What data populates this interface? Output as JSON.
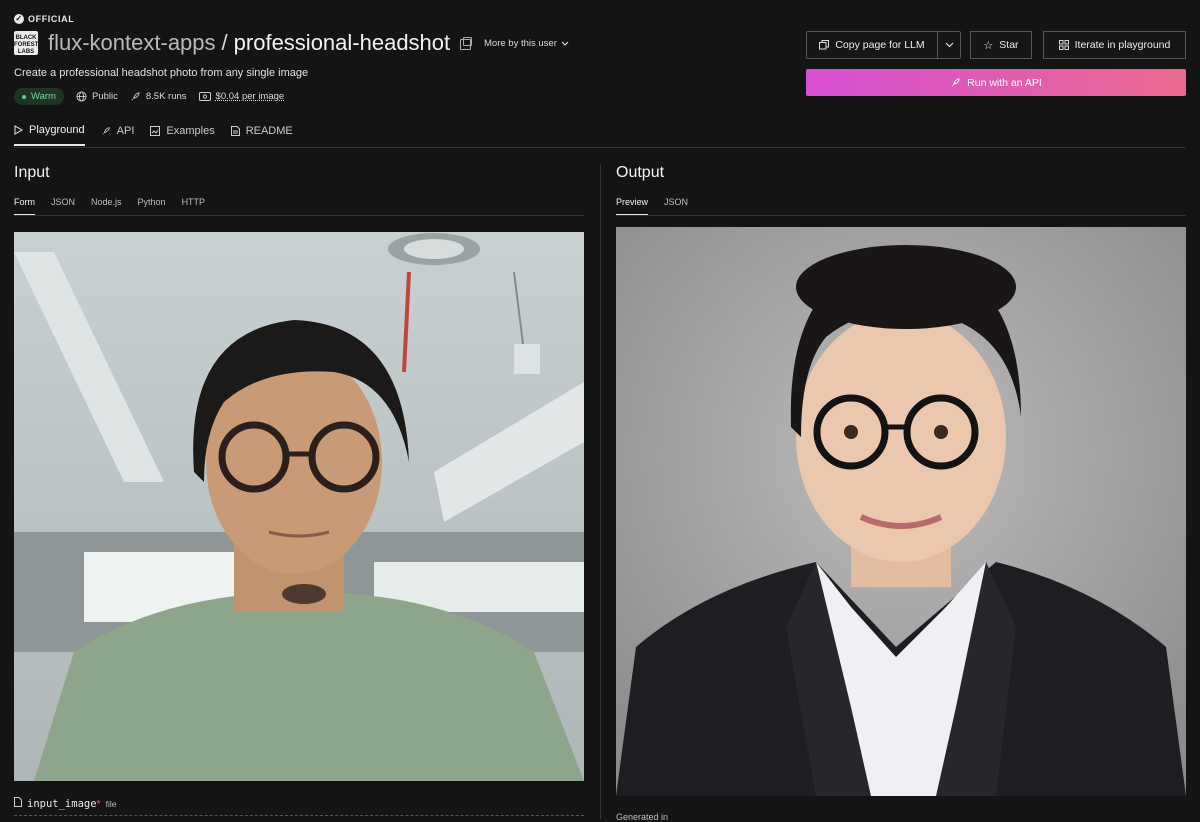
{
  "header": {
    "official": "OFFICIAL",
    "logo_text": "BLACK FOREST LABS",
    "owner": "flux-kontext-apps",
    "separator": "/",
    "model": "professional-headshot",
    "more_by_user": "More by this user",
    "description": "Create a professional headshot photo from any single image",
    "status": "Warm",
    "visibility": "Public",
    "runs": "8.5K runs",
    "price": "$0.04 per image"
  },
  "actions": {
    "copy_page": "Copy page for LLM",
    "star": "Star",
    "iterate": "Iterate in playground",
    "run_api": "Run with an API"
  },
  "tabs": [
    "Playground",
    "API",
    "Examples",
    "README"
  ],
  "input": {
    "heading": "Input",
    "subtabs": [
      "Form",
      "JSON",
      "Node.js",
      "Python",
      "HTTP"
    ],
    "field_name": "input_image",
    "field_required": "*",
    "field_type": "file"
  },
  "output": {
    "heading": "Output",
    "subtabs": [
      "Preview",
      "JSON"
    ],
    "generated": "Generated in"
  },
  "colors": {
    "background": "#141414",
    "run_gradient_start": "#d74fd6",
    "run_gradient_end": "#ea6a8e",
    "status_green": "#5ccf86"
  }
}
